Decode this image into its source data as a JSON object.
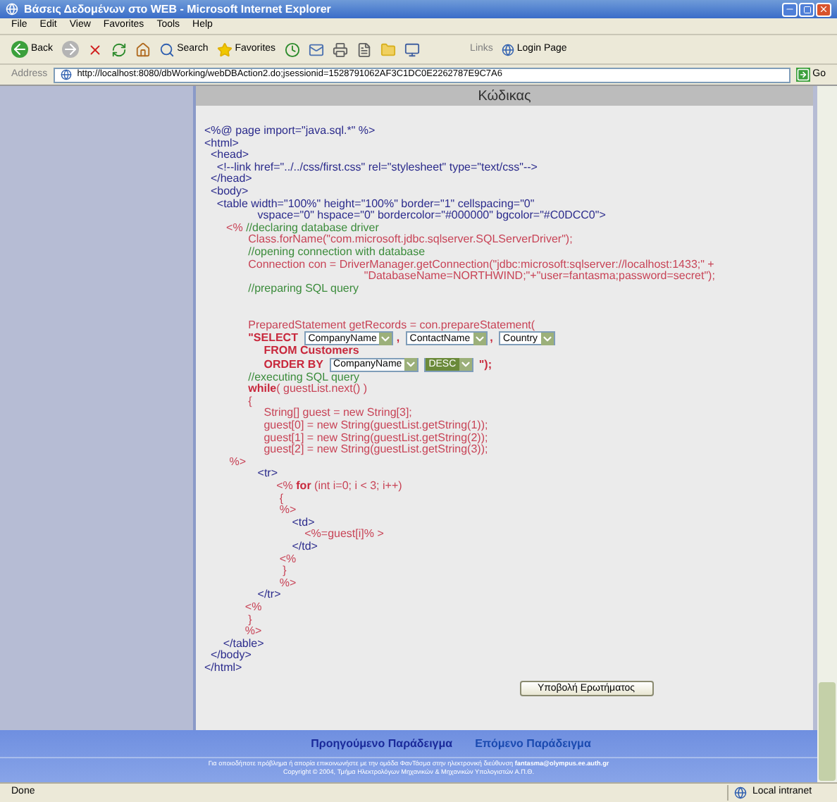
{
  "window": {
    "title": "Βάσεις Δεδομένων στο WEB - Microsoft Internet Explorer"
  },
  "menu": [
    "File",
    "Edit",
    "View",
    "Favorites",
    "Tools",
    "Help"
  ],
  "toolbar": {
    "back": "Back",
    "search": "Search",
    "favorites": "Favorites",
    "links_label": "Links",
    "login": "Login Page"
  },
  "address": {
    "label": "Address",
    "value": "http://localhost:8080/dbWorking/webDBAction2.do;jsessionid=1528791062AF3C1DC0E2262787E9C7A6",
    "go": "Go"
  },
  "panel": {
    "title": "Κώδικας"
  },
  "code": [
    {
      "kind": "text",
      "parts": [
        {
          "kind": "tag",
          "text": "<%@ page import=\"java.sql.*\" %>"
        }
      ]
    },
    {
      "kind": "text",
      "parts": [
        {
          "kind": "tag",
          "text": "<html>"
        }
      ]
    },
    {
      "kind": "text",
      "parts": [
        {
          "kind": "tag",
          "text": "  <head>"
        }
      ]
    },
    {
      "kind": "text",
      "parts": [
        {
          "kind": "tag",
          "text": "    <!--link href=\"../../css/first.css\" rel=\"stylesheet\" type=\"text/css\"-->"
        }
      ]
    },
    {
      "kind": "text",
      "parts": [
        {
          "kind": "tag",
          "text": "  </head>"
        }
      ]
    },
    {
      "kind": "text",
      "parts": [
        {
          "kind": "tag",
          "text": "  <body>"
        }
      ]
    },
    {
      "kind": "text",
      "parts": [
        {
          "kind": "tag",
          "text": "    <table width=\"100%\" height=\"100%\" border=\"1\" cellspacing=\"0\""
        }
      ]
    },
    {
      "kind": "text",
      "parts": [
        {
          "kind": "tag",
          "text": "                 vspace=\"0\" hspace=\"0\" bordercolor=\"#000000\" bgcolor=\"#C0DCC0\">"
        }
      ]
    },
    {
      "kind": "text",
      "parts": [
        {
          "kind": "java",
          "text": "       <% "
        },
        {
          "kind": "comment",
          "text": "//declaring database driver"
        }
      ]
    },
    {
      "kind": "text",
      "parts": [
        {
          "kind": "java",
          "text": "              Class.forName(\"com.microsoft.jdbc.sqlserver.SQLServerDriver\");"
        }
      ]
    },
    {
      "kind": "text",
      "parts": [
        {
          "kind": "comment",
          "text": "              //opening connection with database"
        }
      ]
    },
    {
      "kind": "text",
      "parts": [
        {
          "kind": "java",
          "text": "              Connection con = DriverManager.getConnection(\"jdbc:microsoft:sqlserver://localhost:1433;\" +"
        }
      ]
    },
    {
      "kind": "text",
      "parts": [
        {
          "kind": "java",
          "text": "                                                   \"DatabaseName=NORTHWIND;\"+\"user=fantasma;password=secret\");"
        }
      ]
    },
    {
      "kind": "text",
      "parts": [
        {
          "kind": "comment",
          "text": "              //preparing SQL query"
        }
      ]
    },
    {
      "kind": "blank"
    },
    {
      "kind": "blank"
    },
    {
      "kind": "text",
      "parts": [
        {
          "kind": "java",
          "text": "              PreparedStatement getRecords = con.prepareStatement("
        }
      ]
    },
    {
      "kind": "text",
      "parts": [
        {
          "kind": "keyword",
          "text": "              \"SELECT "
        },
        {
          "kind": "dropdown",
          "value": "CompanyName",
          "focused": false
        },
        {
          "kind": "keyword",
          "text": ", "
        },
        {
          "kind": "dropdown",
          "value": "ContactName",
          "focused": false
        },
        {
          "kind": "keyword",
          "text": ", "
        },
        {
          "kind": "dropdown",
          "value": "Country",
          "focused": false
        }
      ]
    },
    {
      "kind": "text",
      "parts": [
        {
          "kind": "keyword",
          "text": "                   FROM Customers"
        }
      ]
    },
    {
      "kind": "text",
      "parts": [
        {
          "kind": "keyword",
          "text": "                   ORDER BY "
        },
        {
          "kind": "dropdown",
          "value": "CompanyName",
          "focused": false
        },
        {
          "kind": "dropdown",
          "value": "DESC",
          "focused": true
        },
        {
          "kind": "keyword",
          "text": " \");"
        }
      ]
    },
    {
      "kind": "text",
      "parts": [
        {
          "kind": "comment",
          "text": "              //executing SQL query"
        }
      ]
    },
    {
      "kind": "text",
      "parts": [
        {
          "kind": "keyword",
          "text": "              while"
        },
        {
          "kind": "java",
          "text": "( guestList.next() )"
        }
      ]
    },
    {
      "kind": "text",
      "parts": [
        {
          "kind": "java",
          "text": "              {"
        }
      ]
    },
    {
      "kind": "text",
      "parts": [
        {
          "kind": "java",
          "text": "                   String[] guest = new String[3];"
        }
      ]
    },
    {
      "kind": "text",
      "parts": [
        {
          "kind": "java",
          "text": "                   guest[0] = new String(guestList.getString(1));"
        }
      ]
    },
    {
      "kind": "text",
      "parts": [
        {
          "kind": "java",
          "text": "                   guest[1] = new String(guestList.getString(2));"
        }
      ]
    },
    {
      "kind": "text",
      "parts": [
        {
          "kind": "java",
          "text": "                   guest[2] = new String(guestList.getString(3));"
        }
      ]
    },
    {
      "kind": "text",
      "parts": [
        {
          "kind": "java",
          "text": "        %>"
        }
      ]
    },
    {
      "kind": "text",
      "parts": [
        {
          "kind": "tag",
          "text": "                 <tr>"
        }
      ]
    },
    {
      "kind": "text",
      "parts": [
        {
          "kind": "java",
          "text": "                       <% "
        },
        {
          "kind": "keyword",
          "text": "for"
        },
        {
          "kind": "java",
          "text": " (int i=0; i < 3; i++)"
        }
      ]
    },
    {
      "kind": "text",
      "parts": [
        {
          "kind": "java",
          "text": "                        {"
        }
      ]
    },
    {
      "kind": "text",
      "parts": [
        {
          "kind": "java",
          "text": "                        %>"
        }
      ]
    },
    {
      "kind": "text",
      "parts": [
        {
          "kind": "tag",
          "text": "                            <td>"
        }
      ]
    },
    {
      "kind": "text",
      "parts": [
        {
          "kind": "java",
          "text": "                                <%=guest[i]% >"
        }
      ]
    },
    {
      "kind": "text",
      "parts": [
        {
          "kind": "tag",
          "text": "                            </td>"
        }
      ]
    },
    {
      "kind": "text",
      "parts": [
        {
          "kind": "java",
          "text": "                        <%"
        }
      ]
    },
    {
      "kind": "text",
      "parts": [
        {
          "kind": "java",
          "text": "                         }"
        }
      ]
    },
    {
      "kind": "text",
      "parts": [
        {
          "kind": "java",
          "text": "                        %>"
        }
      ]
    },
    {
      "kind": "text",
      "parts": [
        {
          "kind": "tag",
          "text": "                 </tr>"
        }
      ]
    },
    {
      "kind": "text",
      "parts": [
        {
          "kind": "java",
          "text": "             <%"
        }
      ]
    },
    {
      "kind": "text",
      "parts": [
        {
          "kind": "java",
          "text": "              }"
        }
      ]
    },
    {
      "kind": "text",
      "parts": [
        {
          "kind": "java",
          "text": "             %>"
        }
      ]
    },
    {
      "kind": "text",
      "parts": [
        {
          "kind": "tag",
          "text": "      </table>"
        }
      ]
    },
    {
      "kind": "text",
      "parts": [
        {
          "kind": "tag",
          "text": "  </body>"
        }
      ]
    },
    {
      "kind": "text",
      "parts": [
        {
          "kind": "tag",
          "text": "</html>"
        }
      ]
    }
  ],
  "submit": "Υποβολή Ερωτήματος",
  "nav": {
    "previous": "Προηγούμενο Παράδειγμα",
    "next": "Επόμενο Παράδειγμα"
  },
  "footer": {
    "contact": "Για οποιοδήποτε πρόβλημα ή απορία επικοινωνήστε με την ομάδα ΦανΤάσμα στην ηλεκτρονική διεύθυνση **fantasma@olympus.ee.auth.gr**",
    "copyright": "Copyright © 2004, Τμήμα Ηλεκτρολόγων Μηχανικών & Μηχανικών Υπολογιστών Α.Π.Θ."
  },
  "status": {
    "left": "Done",
    "zone": "Local intranet"
  }
}
